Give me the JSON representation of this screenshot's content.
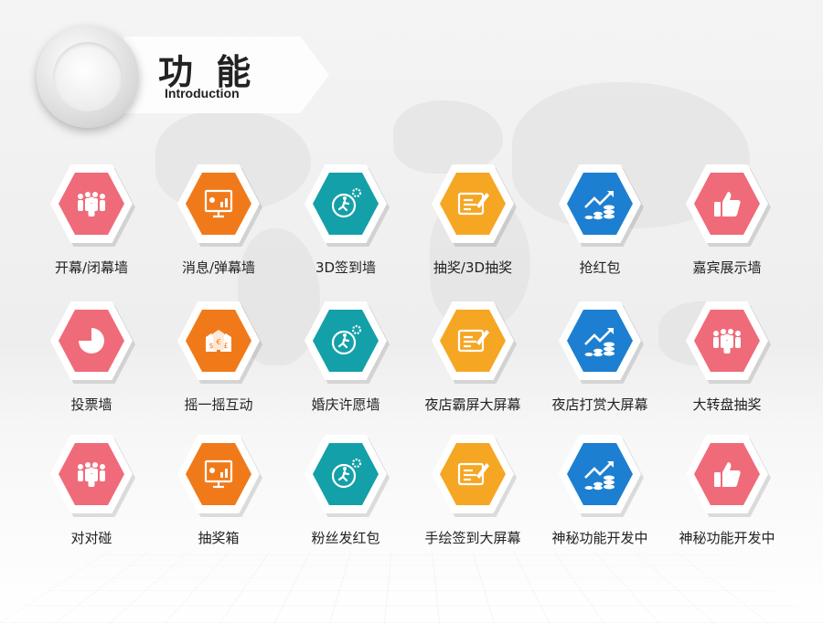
{
  "header": {
    "title": "功 能",
    "subtitle": "Introduction"
  },
  "colors": {
    "pink": "#ef6b79",
    "orange": "#f07a1a",
    "teal": "#14a0a8",
    "yellow": "#f5a623",
    "blue": "#1d7fd1"
  },
  "items": [
    {
      "label": "开幕/闭幕墙",
      "color": "pink",
      "icon": "people-group-icon"
    },
    {
      "label": "消息/弹幕墙",
      "color": "orange",
      "icon": "presentation-board-icon"
    },
    {
      "label": "3D签到墙",
      "color": "teal",
      "icon": "running-gear-icon"
    },
    {
      "label": "抽奖/3D抽奖",
      "color": "yellow",
      "icon": "edit-note-icon"
    },
    {
      "label": "抢红包",
      "color": "blue",
      "icon": "growth-coins-icon"
    },
    {
      "label": "嘉宾展示墙",
      "color": "pink",
      "icon": "thumbs-up-icon"
    },
    {
      "label": "投票墙",
      "color": "pink",
      "icon": "pie-chart-icon"
    },
    {
      "label": "摇一摇互动",
      "color": "orange",
      "icon": "money-bags-icon"
    },
    {
      "label": "婚庆许愿墙",
      "color": "teal",
      "icon": "running-gear-icon"
    },
    {
      "label": "夜店霸屏大屏幕",
      "color": "yellow",
      "icon": "edit-note-icon"
    },
    {
      "label": "夜店打赏大屏幕",
      "color": "blue",
      "icon": "growth-coins-icon"
    },
    {
      "label": "大转盘抽奖",
      "color": "pink",
      "icon": "people-group-icon"
    },
    {
      "label": "对对碰",
      "color": "pink",
      "icon": "people-group-icon"
    },
    {
      "label": "抽奖箱",
      "color": "orange",
      "icon": "presentation-board-icon"
    },
    {
      "label": "粉丝发红包",
      "color": "teal",
      "icon": "running-gear-icon"
    },
    {
      "label": "手绘签到大屏幕",
      "color": "yellow",
      "icon": "edit-note-icon"
    },
    {
      "label": "神秘功能开发中",
      "color": "blue",
      "icon": "growth-coins-icon"
    },
    {
      "label": "神秘功能开发中",
      "color": "pink",
      "icon": "thumbs-up-icon"
    }
  ]
}
